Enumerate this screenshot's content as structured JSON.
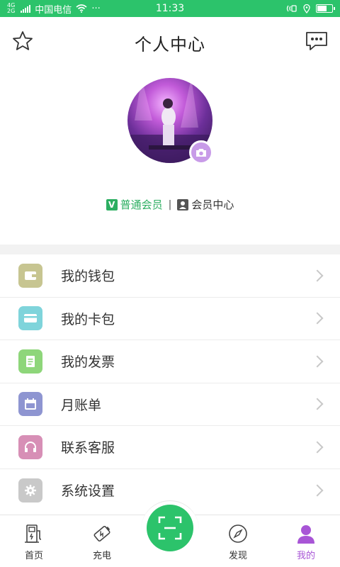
{
  "statusbar": {
    "network": "4G",
    "network2": "2G",
    "carrier": "中国电信",
    "dots": "···",
    "time": "11:33",
    "battery_level": 0.6
  },
  "header": {
    "title": "个人中心"
  },
  "member": {
    "badge": "V",
    "level": "普通会员",
    "separator": "|",
    "center": "会员中心"
  },
  "menu": {
    "items": [
      {
        "label": "我的钱包",
        "icon": "wallet-icon",
        "color": "#c7c591"
      },
      {
        "label": "我的卡包",
        "icon": "card-icon",
        "color": "#7fd4db"
      },
      {
        "label": "我的发票",
        "icon": "invoice-icon",
        "color": "#8ed67a"
      },
      {
        "label": "月账单",
        "icon": "calendar-icon",
        "color": "#8e95d1"
      },
      {
        "label": "联系客服",
        "icon": "headset-icon",
        "color": "#d78fb6"
      },
      {
        "label": "系统设置",
        "icon": "gear-icon",
        "color": "#c9c9c9"
      }
    ]
  },
  "nav": {
    "home": "首页",
    "charge": "充电",
    "discover": "发现",
    "mine": "我的"
  },
  "colors": {
    "accent": "#2cc36b",
    "active": "#a855d6",
    "member": "#2cae61"
  }
}
